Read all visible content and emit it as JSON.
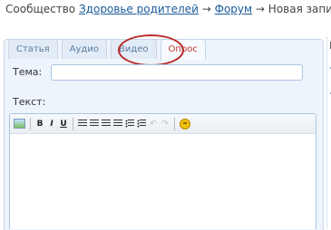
{
  "breadcrumb": {
    "prefix": "Сообщество",
    "community_link": "Здоровье родителей",
    "sep1": "→",
    "forum_link": "Форум",
    "sep2": "→",
    "current": "Новая запись"
  },
  "tabs": [
    {
      "label": "Статья",
      "active": false
    },
    {
      "label": "Аудио",
      "active": false
    },
    {
      "label": "Видео",
      "active": false
    },
    {
      "label": "Опрос",
      "active": true
    }
  ],
  "form": {
    "topic_label": "Тема:",
    "topic_value": "",
    "text_label": "Текст:"
  },
  "toolbar": {
    "bold": "B",
    "italic": "I",
    "underline": "U",
    "undo": "↶",
    "redo": "↷"
  },
  "right_rail": {
    "fragment": "П"
  },
  "colors": {
    "link": "#1a5a9a",
    "active_tab_text": "#c0392b",
    "highlight_circle": "#b92b2b",
    "panel_bg": "#eef4fb"
  }
}
